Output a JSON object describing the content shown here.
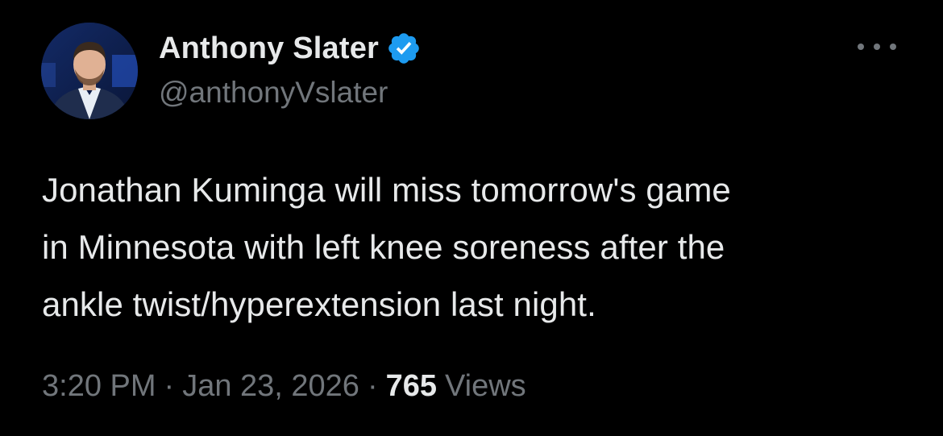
{
  "tweet": {
    "author": {
      "display_name": "Anthony Slater",
      "handle": "@anthonyVslater",
      "verified": true,
      "avatar_icon": "user-avatar-photo",
      "badge_icon": "verified-badge-icon"
    },
    "text": "Jonathan Kuminga will miss tomorrow's game\nin Minnesota with left knee soreness after the\nankle twist/hyperextension last night.",
    "time": "3:20 PM",
    "separator": "·",
    "date": "Jan 23, 2026",
    "views_count": "765",
    "views_label": "Views",
    "more_icon": "more-options-icon"
  },
  "colors": {
    "background": "#000000",
    "primary_text": "#e7e9ea",
    "secondary_text": "#71767b",
    "verified_blue": "#1d9bf0"
  }
}
